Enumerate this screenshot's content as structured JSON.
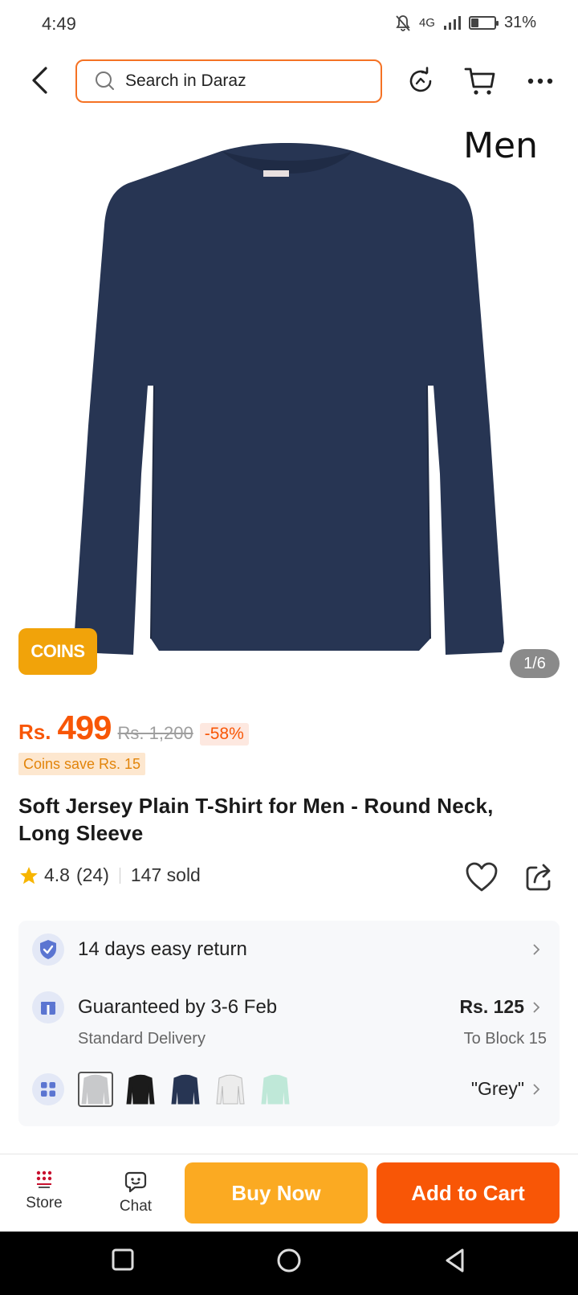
{
  "status_bar": {
    "time": "4:49",
    "network": "4G",
    "battery": "31%",
    "battery_level": 0.31
  },
  "search": {
    "placeholder": "Search in Daraz"
  },
  "product_image": {
    "caption": "Men",
    "counter": "1/6",
    "coins_badge": "COINS"
  },
  "price": {
    "currency": "Rs.",
    "current": "499",
    "original": "Rs. 1,200",
    "discount": "-58%",
    "coins_save": "Coins save Rs. 15"
  },
  "title": "Soft Jersey Plain T-Shirt for Men - Round Neck, Long Sleeve",
  "rating": {
    "score": "4.8",
    "count": "(24)",
    "sold": "147 sold",
    "stars": 4.8
  },
  "info": {
    "returns": "14 days easy return",
    "delivery_main": "Guaranteed by 3-6 Feb",
    "delivery_sub": "Standard Delivery",
    "delivery_fee": "Rs. 125",
    "delivery_location": "To Block 15",
    "variant_selected": "\"Grey\""
  },
  "variants": [
    {
      "color": "#c8c9cb"
    },
    {
      "color": "#1b1b1b"
    },
    {
      "color": "#273553"
    },
    {
      "color": "#ececec"
    },
    {
      "color": "#bfe8d8"
    }
  ],
  "actions": {
    "store": "Store",
    "chat": "Chat",
    "buy_now": "Buy Now",
    "add_to_cart": "Add to Cart"
  },
  "colors": {
    "accent": "#f85606",
    "buy_now": "#fbaa22",
    "coins": "#f1a30a",
    "shirt": "#273553"
  }
}
